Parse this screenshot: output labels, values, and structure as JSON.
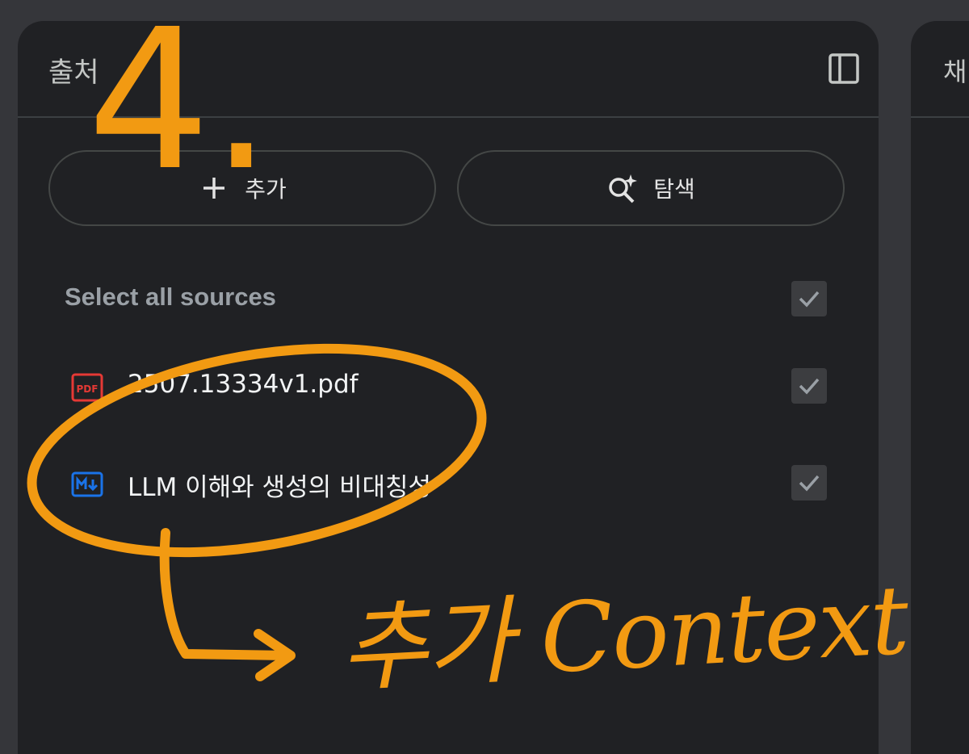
{
  "panel": {
    "title": "출처",
    "buttons": {
      "add_label": "추가",
      "explore_label": "탐색"
    },
    "select_all_label": "Select all sources",
    "sources": [
      {
        "name": "2507.13334v1.pdf",
        "icon": "pdf-icon",
        "checked": true
      },
      {
        "name": "LLM 이해와 생성의 비대칭성",
        "icon": "markdown-icon",
        "checked": true
      }
    ]
  },
  "right_panel": {
    "title_partial": "채"
  },
  "annotation": {
    "number": "4.",
    "text": "추가 Context"
  },
  "colors": {
    "background": "#35363a",
    "panel": "#202124",
    "annotation": "#f29a12",
    "pdf_icon": "#e53935",
    "markdown_icon": "#1a73e8"
  }
}
